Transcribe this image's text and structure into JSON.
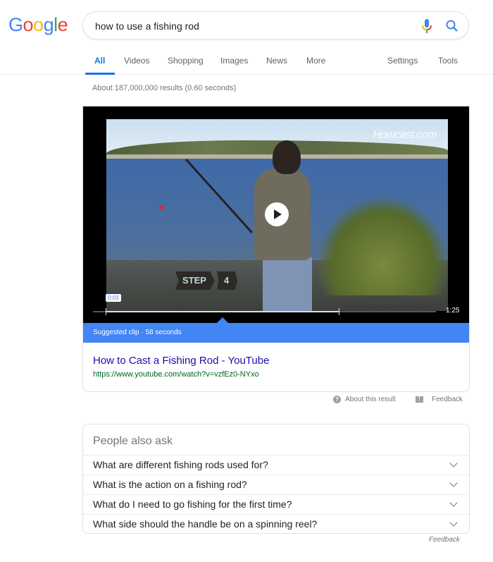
{
  "logo": {
    "letters": [
      "G",
      "o",
      "o",
      "g",
      "l",
      "e"
    ]
  },
  "search": {
    "query": "how to use a fishing rod",
    "mic_icon": "microphone-icon",
    "search_icon": "magnifier-icon"
  },
  "tabs": [
    {
      "label": "All",
      "active": true
    },
    {
      "label": "Videos"
    },
    {
      "label": "Shopping"
    },
    {
      "label": "Images"
    },
    {
      "label": "News"
    },
    {
      "label": "More"
    },
    {
      "label": "Settings"
    },
    {
      "label": "Tools"
    }
  ],
  "stats": "About 187,000,000 results (0.60 seconds)",
  "video": {
    "watermark": "Howcast.com",
    "step_label": "STEP",
    "step_number": "4",
    "clip_start": "0:03",
    "duration": "1:25",
    "clip_bar": "Suggested clip · 58 seconds"
  },
  "result": {
    "title": "How to Cast a Fishing Rod - YouTube",
    "url": "https://www.youtube.com/watch?v=vzfEz0-NYxo"
  },
  "meta": {
    "about": "About this result",
    "feedback": "Feedback"
  },
  "paa": {
    "title": "People also ask",
    "questions": [
      "What are different fishing rods used for?",
      "What is the action on a fishing rod?",
      "What do I need to go fishing for the first time?",
      "What side should the handle be on a spinning reel?"
    ],
    "feedback": "Feedback"
  }
}
